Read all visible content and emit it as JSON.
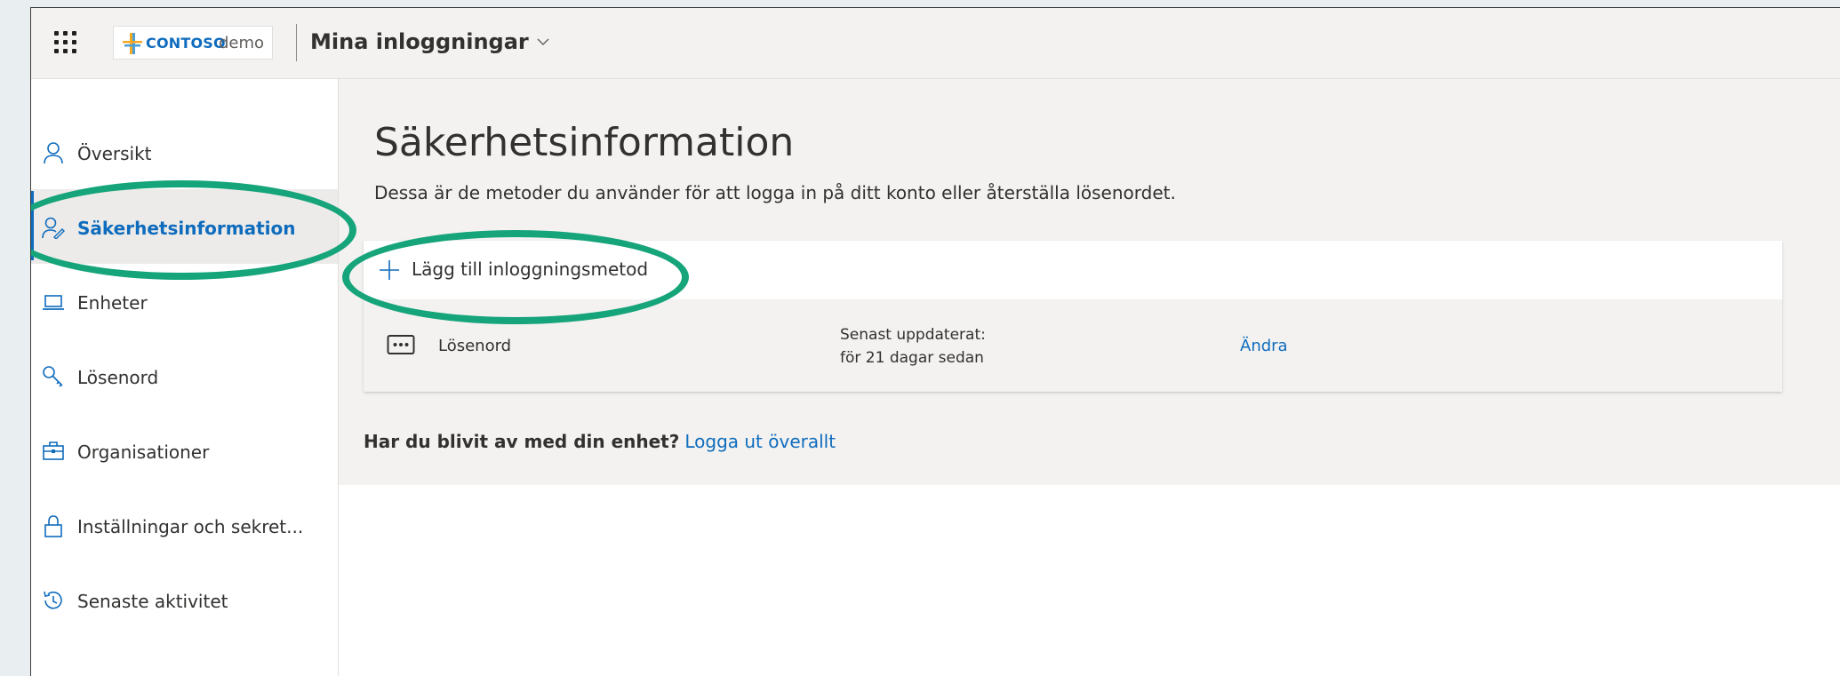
{
  "header": {
    "brand": "CONTOSO",
    "brand_suffix": "demo",
    "app_title": "Mina inloggningar"
  },
  "sidebar": {
    "items": [
      {
        "label": "Översikt",
        "icon": "person-icon"
      },
      {
        "label": "Säkerhetsinformation",
        "icon": "security-info-icon",
        "active": true
      },
      {
        "label": "Enheter",
        "icon": "laptop-icon"
      },
      {
        "label": "Lösenord",
        "icon": "key-icon"
      },
      {
        "label": "Organisationer",
        "icon": "briefcase-icon"
      },
      {
        "label": "Inställningar och sekret...",
        "icon": "lock-icon"
      },
      {
        "label": "Senaste aktivitet",
        "icon": "history-icon"
      }
    ]
  },
  "main": {
    "title": "Säkerhetsinformation",
    "description": "Dessa är de metoder du använder för att logga in på ditt konto eller återställa lösenordet.",
    "add_method_label": "Lägg till inloggningsmetod",
    "methods": [
      {
        "name": "Lösenord",
        "updated_label": "Senast uppdaterat:",
        "updated_value": "för 21 dagar sedan",
        "action": "Ändra"
      }
    ],
    "lost_device_question": "Har du blivit av med din enhet?",
    "lost_device_link": "Logga ut överallt"
  },
  "colors": {
    "accent": "#0f6cbd",
    "highlight": "#16a47a",
    "topbar_bg": "#f3f2f1"
  }
}
